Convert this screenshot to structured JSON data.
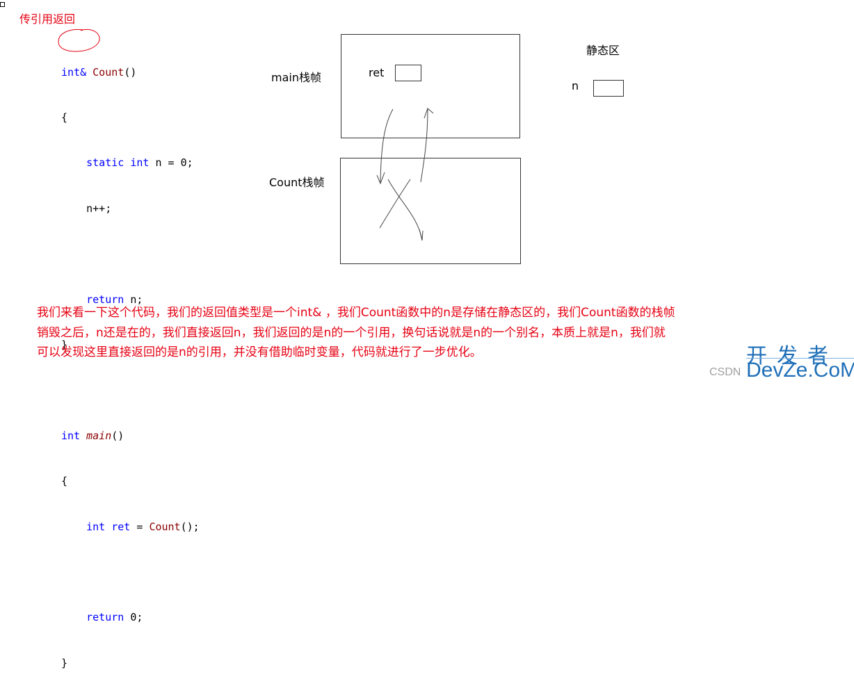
{
  "section_title": "传引用返回",
  "code": {
    "line1": {
      "type": "int&",
      "fn": "Count",
      "rest": "()"
    },
    "line2": "{",
    "line3": {
      "kw1": "static",
      "kw2": "int",
      "rest": "n = 0;"
    },
    "line4": "n++;",
    "line5": {
      "kw": "return",
      "rest": "n;"
    },
    "line6": "}",
    "line7": {
      "kw": "int",
      "fn": "main",
      "rest": "()"
    },
    "line8": "{",
    "line9": {
      "kw": "int",
      "var": "ret",
      "eq": "=",
      "fn": "Count",
      "rest": "();"
    },
    "line10": {
      "kw": "return",
      "rest": "0;"
    },
    "line11": "}"
  },
  "diagram": {
    "main_frame_label": "main栈帧",
    "count_frame_label": "Count栈帧",
    "static_area_label": "静态区",
    "ret_label": "ret",
    "n_label": "n"
  },
  "paragraph": {
    "line1": "我们来看一下这个代码，我们的返回值类型是一个int& ，我们Count函数中的n是存储在静态区的，我们Count函数的栈帧",
    "line2": "销毁之后，n还是在的，我们直接返回n，我们返回的是n的一个引用，换句话说就是n的一个别名，本质上就是n，我们就",
    "line3": "可以发现这里直接返回的是n的引用，并没有借助临时变量，代码就进行了一步优化。"
  },
  "watermark": {
    "csdn": "CSDN",
    "devze_cn": "开发者",
    "devze_en": "DevZe.CoM"
  },
  "colors": {
    "annotation_red": "#e60012",
    "keyword_blue": "#0000ff",
    "function_darkred": "#8b0000",
    "watermark_blue": "#1e6fb8"
  }
}
